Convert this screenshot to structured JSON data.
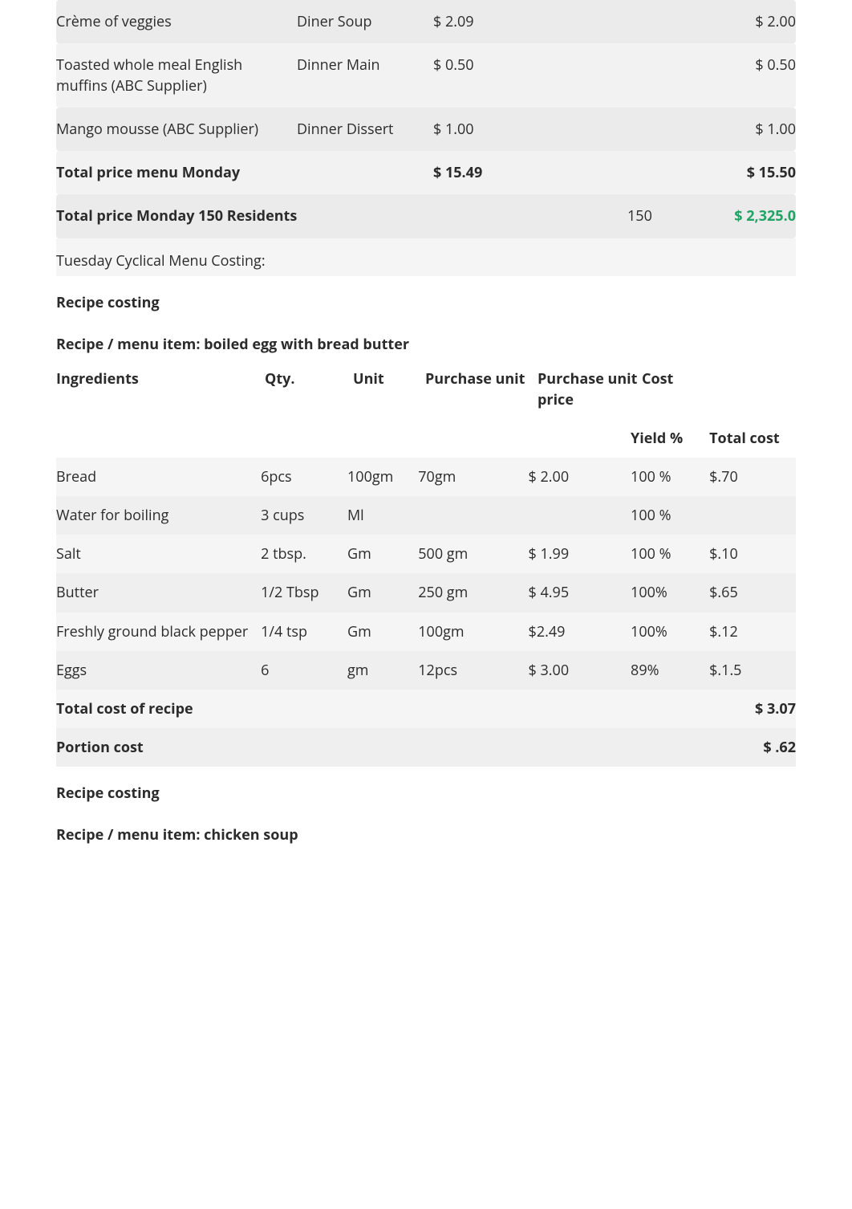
{
  "menu": {
    "rows": [
      {
        "item": "Crème of veggies",
        "meal": "Diner Soup",
        "price": "$ 2.09",
        "qty": "",
        "ext": "$ 2.00"
      },
      {
        "item": "Toasted whole meal English muffins (ABC Supplier)",
        "meal": "Dinner Main",
        "price": "$ 0.50",
        "qty": "",
        "ext": "$ 0.50"
      },
      {
        "item": "Mango mousse (ABC Supplier)",
        "meal": "Dinner Dissert",
        "price": "$ 1.00",
        "qty": "",
        "ext": "$ 1.00"
      }
    ],
    "total_label": "Total price menu Monday",
    "total_price": "$ 15.49",
    "total_ext": "$ 15.50",
    "grand_label": "Total price Monday 150 Residents",
    "grand_qty": "150",
    "grand_ext": "$ 2,325.0",
    "sub_section": "Tuesday Cyclical Menu Costing:"
  },
  "recipe1": {
    "costing_label": "Recipe costing",
    "title": "Recipe / menu item: boiled egg with bread butter",
    "headers": {
      "ing": "Ingredients",
      "qty": "Qty.",
      "unit": "Unit",
      "pu": "Purchase unit",
      "pup": "Purchase unit price",
      "cost": "Cost",
      "yield": "Yield %",
      "total": "Total cost"
    },
    "rows": [
      {
        "ing": "Bread",
        "qty": "6pcs",
        "unit": "100gm",
        "pu": "70gm",
        "pup": "$ 2.00",
        "yield": "100 %",
        "total": "$.70"
      },
      {
        "ing": "Water for boiling",
        "qty": "3 cups",
        "unit": "Ml",
        "pu": "",
        "pup": "",
        "yield": "100 %",
        "total": ""
      },
      {
        "ing": "Salt",
        "qty": "2 tbsp.",
        "unit": "Gm",
        "pu": "500 gm",
        "pup": "$ 1.99",
        "yield": "100 %",
        "total": "$.10"
      },
      {
        "ing": "Butter",
        "qty": "1/2 Tbsp",
        "unit": "Gm",
        "pu": "250 gm",
        "pup": "$ 4.95",
        "yield": "100%",
        "total": "$.65"
      },
      {
        "ing": "Freshly ground black pepper",
        "qty": "1/4 tsp",
        "unit": "Gm",
        "pu": "100gm",
        "pup": "$2.49",
        "yield": "100%",
        "total": "$.12"
      },
      {
        "ing": "Eggs",
        "qty": "6",
        "unit": "gm",
        "pu": "12pcs",
        "pup": "$ 3.00",
        "yield": "89%",
        "total": "$.1.5"
      }
    ],
    "total_recipe_label": "Total cost of recipe",
    "total_recipe_value": "$ 3.07",
    "portion_label": "Portion cost",
    "portion_value": "$ .62"
  },
  "recipe2": {
    "costing_label": "Recipe costing",
    "title": "Recipe / menu item: chicken soup"
  }
}
